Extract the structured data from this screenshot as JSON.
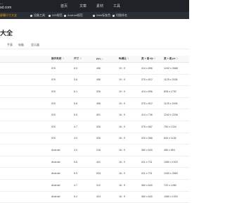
{
  "header": {
    "logo_line1": "...",
    "logo_line2": "sd.com",
    "nav": [
      "首页",
      "文章",
      "素材",
      "工具"
    ]
  },
  "subnav": [
    {
      "label": "屏幕尺寸大全",
      "active": true
    },
    {
      "label": "设备工具",
      "active": false
    },
    {
      "label": "iOS规范",
      "active": false
    },
    {
      "label": "Android规范",
      "active": false
    },
    {
      "label": "Web标准色",
      "active": false
    },
    {
      "label": "切图命名",
      "active": false
    }
  ],
  "page": {
    "title": "大全"
  },
  "tabs": [
    "手表",
    "电脑",
    "显示器"
  ],
  "table": {
    "headers": [
      "",
      "操作系统",
      "尺寸",
      "PPI",
      "纵横比",
      "宽 × 高 dp",
      "宽 × 高 px"
    ],
    "rows": [
      [
        "",
        "iOS",
        "6.5",
        "458",
        "19 : 9",
        "414 x 896",
        "1242 x 2688"
      ],
      [
        "",
        "iOS",
        "5.8",
        "458",
        "19 : 9",
        "375 x 812",
        "1125 x 2436"
      ],
      [
        "",
        "iOS",
        "6.1",
        "326",
        "19 : 9",
        "414 x 896",
        "828 x 1792"
      ],
      [
        "",
        "iOS",
        "5.8",
        "458",
        "19 : 9",
        "375 x 812",
        "1125 x 2436"
      ],
      [
        "",
        "iOS",
        "5.5",
        "401",
        "16 : 9",
        "414 x 736",
        "1242 x 2208"
      ],
      [
        "",
        "iOS",
        "4.7",
        "326",
        "16 : 9",
        "375 x 667",
        "750 x 1334"
      ],
      [
        "",
        "iOS",
        "4.0",
        "326",
        "16 : 9",
        "320 x 568",
        "640 x 1136"
      ],
      [
        "",
        "Android",
        "4.0",
        "218",
        "16 : 9",
        "360 x 640",
        "480 x 854"
      ],
      [
        "",
        "Android",
        "5.6",
        "441",
        "16 : 9",
        "411 x 731",
        "1080 x 1920"
      ],
      [
        "",
        "Android",
        "5.5",
        "534",
        "16 : 9",
        "411 x 731",
        "1440 x 2560"
      ],
      [
        "",
        "Android",
        "4.7",
        "312",
        "16 : 9",
        "360 x 640",
        "720 x 1280"
      ],
      [
        "",
        "Android",
        "5.2",
        "424",
        "16 : 9",
        "360 x 640",
        "1080 x 1920"
      ]
    ]
  }
}
